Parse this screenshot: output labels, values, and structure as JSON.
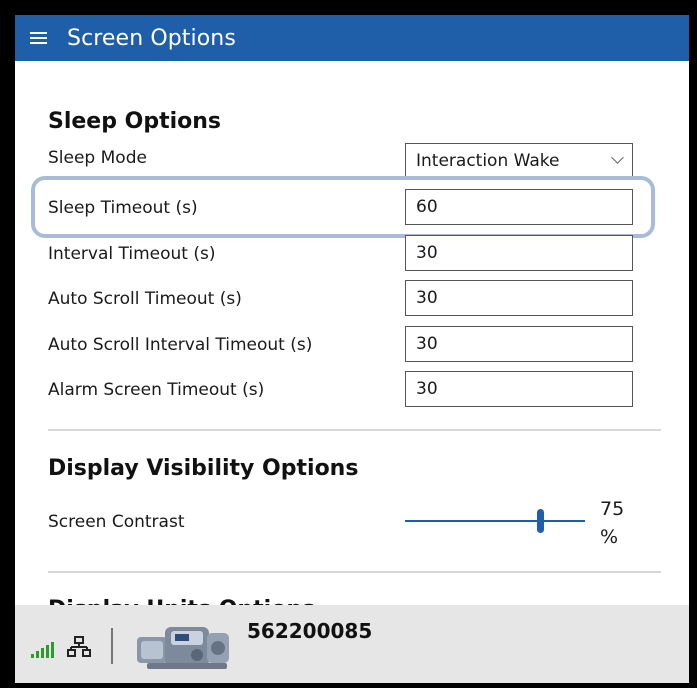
{
  "window": {
    "title": "Screen Options"
  },
  "sleep_options": {
    "heading": "Sleep Options",
    "sleep_mode": {
      "label": "Sleep Mode",
      "value": "Interaction Wake"
    },
    "sleep_timeout": {
      "label": "Sleep Timeout (s)",
      "value": "60"
    },
    "interval_timeout": {
      "label": "Interval Timeout (s)",
      "value": "30"
    },
    "auto_scroll_timeout": {
      "label": "Auto Scroll Timeout (s)",
      "value": "30"
    },
    "auto_scroll_interval_timeout": {
      "label": "Auto Scroll Interval Timeout (s)",
      "value": "30"
    },
    "alarm_screen_timeout": {
      "label": "Alarm Screen Timeout (s)",
      "value": "30"
    }
  },
  "display_visibility": {
    "heading": "Display Visibility Options",
    "screen_contrast": {
      "label": "Screen Contrast",
      "value": 75,
      "value_text": "75",
      "unit": "%"
    }
  },
  "display_units": {
    "heading": "Display Units Options"
  },
  "status_bar": {
    "serial_number": "562200085",
    "signal_icon": "signal-bars-icon",
    "network_icon": "network-icon",
    "device_image": "actuator-device-image"
  },
  "colors": {
    "titlebar": "#1f5ea8",
    "accent": "#1f5ea8",
    "highlight_outline": "#a9bcd7",
    "status_bar_bg": "#e6e6e6",
    "signal_green": "#2d9b2d"
  }
}
